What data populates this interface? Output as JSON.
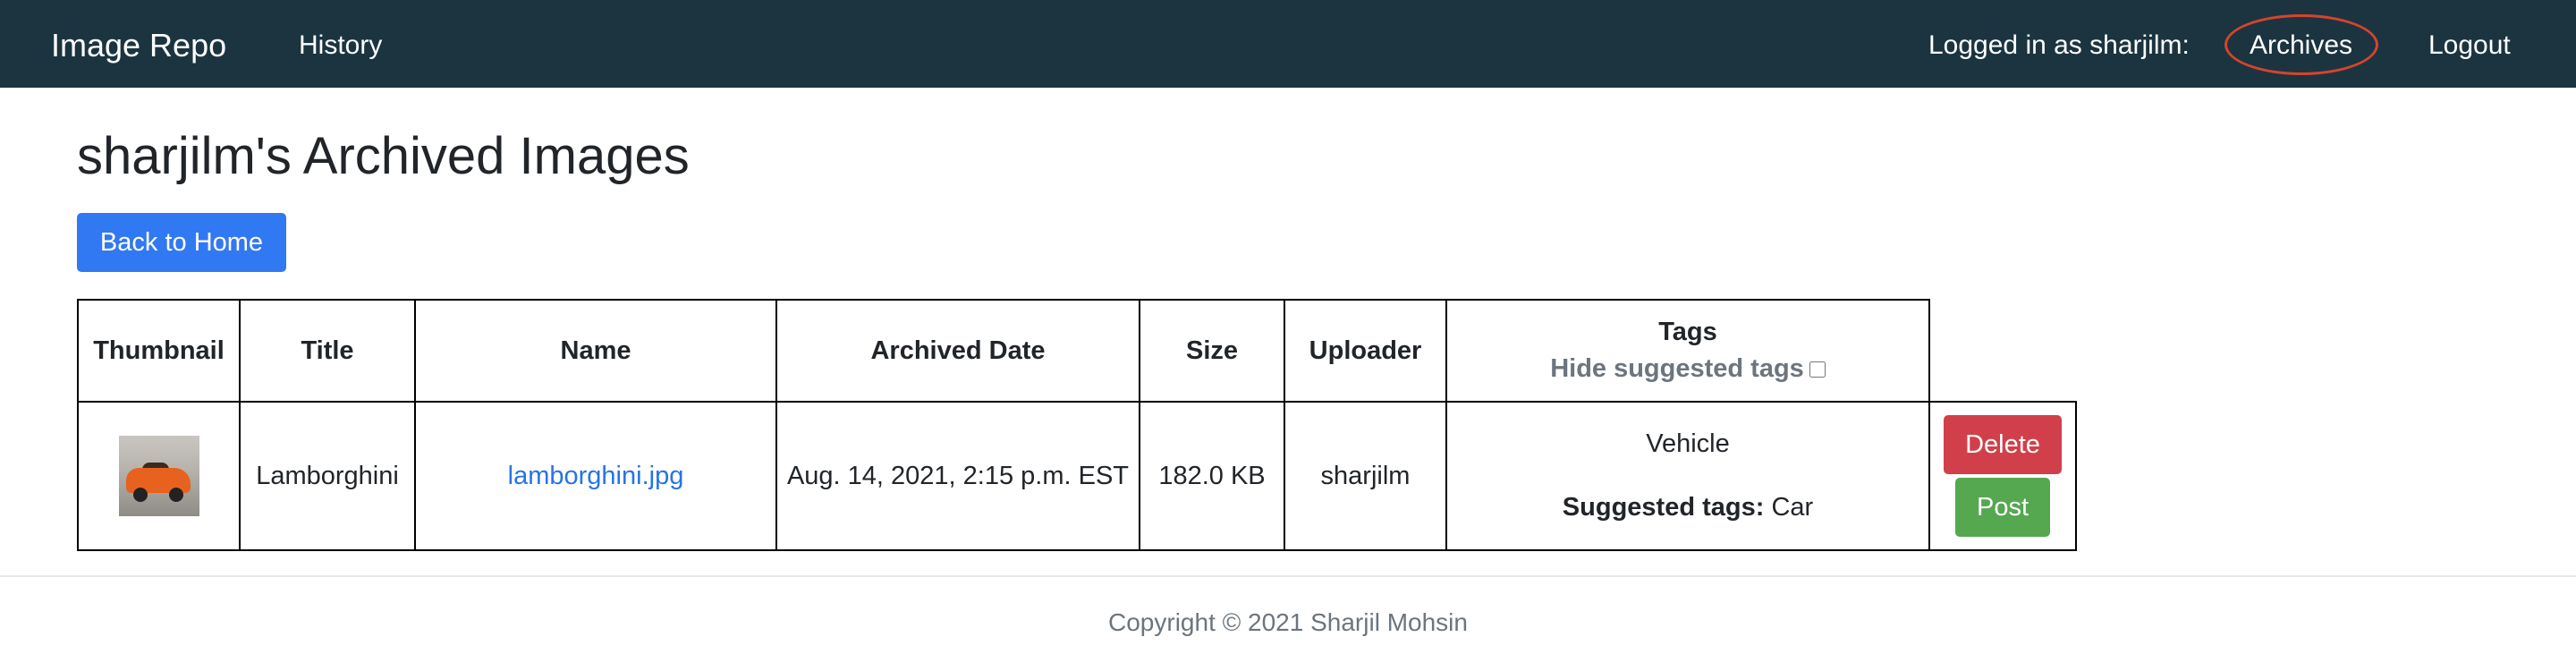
{
  "navbar": {
    "brand": "Image Repo",
    "history": "History",
    "logged_in_text": "Logged in as sharjilm:",
    "archives": "Archives",
    "logout": "Logout"
  },
  "page": {
    "title": "sharjilm's Archived Images",
    "back_button": "Back to Home"
  },
  "table": {
    "headers": {
      "thumbnail": "Thumbnail",
      "title": "Title",
      "name": "Name",
      "archived_date": "Archived Date",
      "size": "Size",
      "uploader": "Uploader",
      "tags": "Tags",
      "hide_suggested": "Hide suggested tags"
    },
    "rows": [
      {
        "thumbnail_icon": "lamborghini-thumbnail",
        "title": "Lamborghini",
        "name": "lamborghini.jpg",
        "archived_date": "Aug. 14, 2021, 2:15 p.m. EST",
        "size": "182.0 KB",
        "uploader": "sharjilm",
        "tag": "Vehicle",
        "suggested_label": "Suggested tags:",
        "suggested_tags": "Car",
        "delete_label": "Delete",
        "post_label": "Post"
      }
    ]
  },
  "footer": {
    "copyright": "Copyright © 2021 Sharjil Mohsin"
  },
  "colors": {
    "navbar_bg": "#1b3440",
    "primary": "#3178f3",
    "danger": "#d1404a",
    "success": "#55a850",
    "annotation_circle": "#d8432b"
  }
}
